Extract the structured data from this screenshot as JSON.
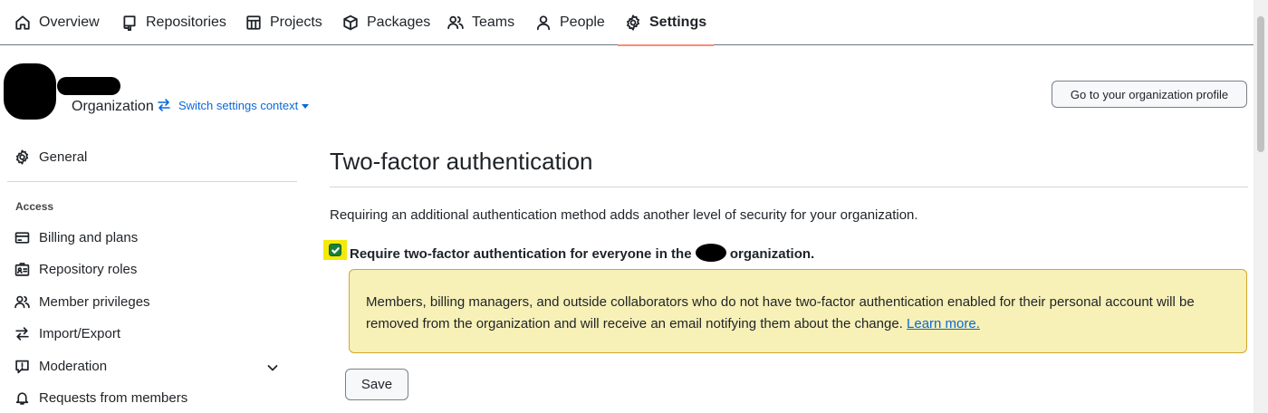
{
  "nav": {
    "items": [
      {
        "label": "Overview",
        "icon": "home-icon"
      },
      {
        "label": "Repositories",
        "icon": "repo-icon"
      },
      {
        "label": "Projects",
        "icon": "project-icon"
      },
      {
        "label": "Packages",
        "icon": "package-icon"
      },
      {
        "label": "Teams",
        "icon": "people-icon"
      },
      {
        "label": "People",
        "icon": "person-icon"
      },
      {
        "label": "Settings",
        "icon": "gear-icon",
        "active": true
      }
    ]
  },
  "org": {
    "type_label": "Organization",
    "switch_context_label": "Switch settings context",
    "profile_button": "Go to your organization profile"
  },
  "sidebar": {
    "general": "General",
    "access_heading": "Access",
    "items": [
      {
        "label": "Billing and plans",
        "icon": "credit-card-icon"
      },
      {
        "label": "Repository roles",
        "icon": "id-badge-icon"
      },
      {
        "label": "Member privileges",
        "icon": "people-icon"
      },
      {
        "label": "Import/Export",
        "icon": "arrow-switch-icon"
      },
      {
        "label": "Moderation",
        "icon": "report-icon",
        "expandable": true
      },
      {
        "label": "Requests from members",
        "icon": "bell-icon"
      }
    ]
  },
  "main": {
    "title": "Two-factor authentication",
    "description": "Requiring an additional authentication method adds another level of security for your organization.",
    "checkbox": {
      "checked": true,
      "label_before": "Require two-factor authentication for everyone in the ",
      "label_after": " organization."
    },
    "warning": {
      "text": "Members, billing managers, and outside collaborators who do not have two-factor authentication enabled for their personal account will be removed from the organization and will receive an email notifying them about the change.",
      "link": "Learn more."
    },
    "save_label": "Save"
  },
  "colors": {
    "accent": "#0969da",
    "active_underline": "#fd8c73",
    "checkbox_checked": "#1a7f37",
    "warning_bg": "#f7f0b7",
    "highlight": "#f5e90a"
  }
}
